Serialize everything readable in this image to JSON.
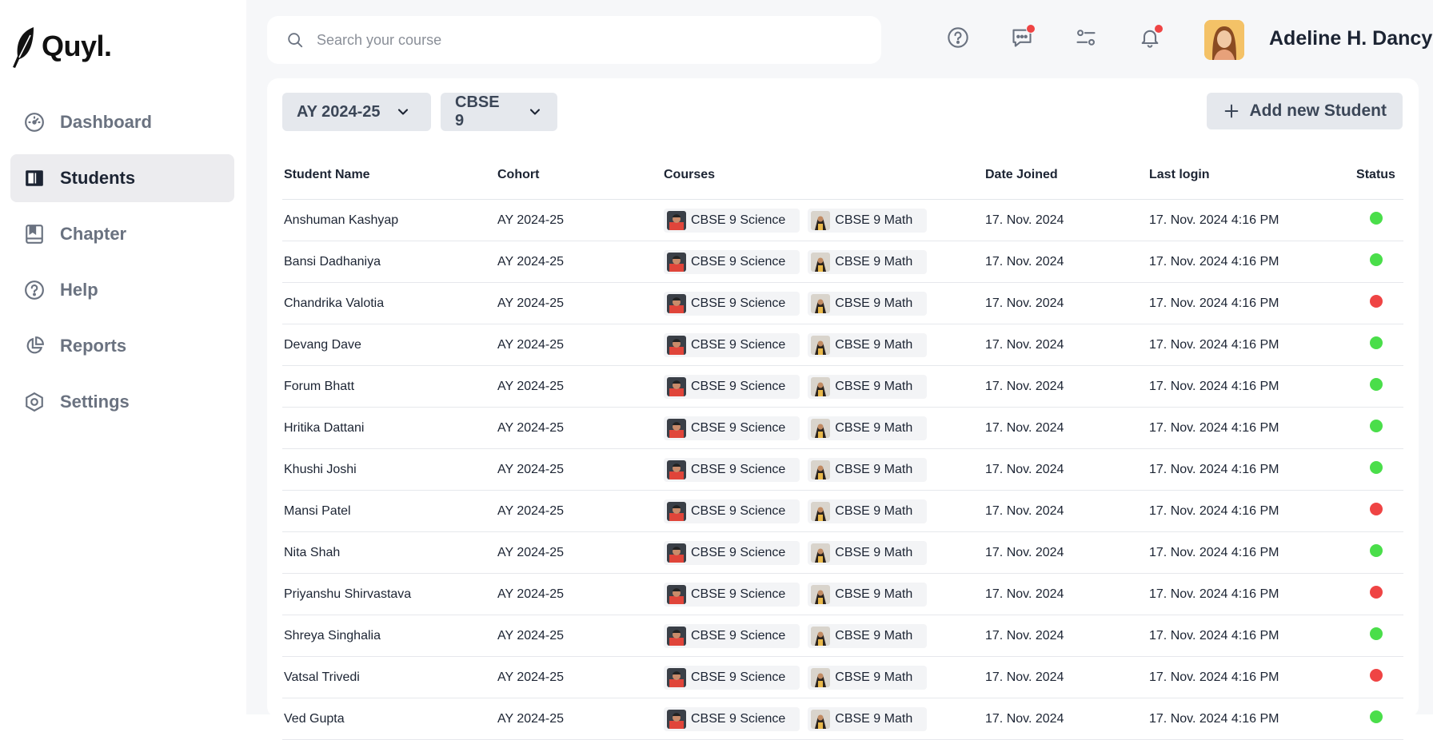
{
  "app": {
    "name": "Quyl."
  },
  "sidebar": {
    "items": [
      {
        "label": "Dashboard",
        "icon": "dashboard-gauge-icon",
        "active": false
      },
      {
        "label": "Students",
        "icon": "book-open-icon",
        "active": true
      },
      {
        "label": "Chapter",
        "icon": "bookmark-book-icon",
        "active": false
      },
      {
        "label": "Help",
        "icon": "help-circle-icon",
        "active": false
      },
      {
        "label": "Reports",
        "icon": "pie-chart-icon",
        "active": false
      },
      {
        "label": "Settings",
        "icon": "settings-hexagon-icon",
        "active": false
      }
    ]
  },
  "header": {
    "search_placeholder": "Search your course",
    "user_name": "Adeline H. Dancy"
  },
  "filters": {
    "year": "AY 2024-25",
    "class": "CBSE 9",
    "add_button": "Add new Student"
  },
  "table": {
    "columns": [
      "Student Name",
      "Cohort",
      "Courses",
      "Date Joined",
      "Last login",
      "Status"
    ],
    "rows": [
      {
        "name": "Anshuman Kashyap",
        "cohort": "AY 2024-25",
        "course1": "CBSE 9 Science",
        "course2": "CBSE 9 Math",
        "joined": "17. Nov. 2024",
        "last_login": "17. Nov. 2024 4:16 PM",
        "status": "active"
      },
      {
        "name": "Bansi Dadhaniya",
        "cohort": "AY 2024-25",
        "course1": "CBSE 9 Science",
        "course2": "CBSE 9 Math",
        "joined": "17. Nov. 2024",
        "last_login": "17. Nov. 2024 4:16 PM",
        "status": "active"
      },
      {
        "name": "Chandrika Valotia",
        "cohort": "AY 2024-25",
        "course1": "CBSE 9 Science",
        "course2": "CBSE 9 Math",
        "joined": "17. Nov. 2024",
        "last_login": "17. Nov. 2024 4:16 PM",
        "status": "inactive"
      },
      {
        "name": "Devang Dave",
        "cohort": "AY 2024-25",
        "course1": "CBSE 9 Science",
        "course2": "CBSE 9 Math",
        "joined": "17. Nov. 2024",
        "last_login": "17. Nov. 2024 4:16 PM",
        "status": "active"
      },
      {
        "name": "Forum Bhatt",
        "cohort": "AY 2024-25",
        "course1": "CBSE 9 Science",
        "course2": "CBSE 9 Math",
        "joined": "17. Nov. 2024",
        "last_login": "17. Nov. 2024 4:16 PM",
        "status": "active"
      },
      {
        "name": "Hritika Dattani",
        "cohort": "AY 2024-25",
        "course1": "CBSE 9 Science",
        "course2": "CBSE 9 Math",
        "joined": "17. Nov. 2024",
        "last_login": "17. Nov. 2024 4:16 PM",
        "status": "active"
      },
      {
        "name": "Khushi Joshi",
        "cohort": "AY 2024-25",
        "course1": "CBSE 9 Science",
        "course2": "CBSE 9 Math",
        "joined": "17. Nov. 2024",
        "last_login": "17. Nov. 2024 4:16 PM",
        "status": "active"
      },
      {
        "name": "Mansi Patel",
        "cohort": "AY 2024-25",
        "course1": "CBSE 9 Science",
        "course2": "CBSE 9 Math",
        "joined": "17. Nov. 2024",
        "last_login": "17. Nov. 2024 4:16 PM",
        "status": "inactive"
      },
      {
        "name": "Nita Shah",
        "cohort": "AY 2024-25",
        "course1": "CBSE 9 Science",
        "course2": "CBSE 9 Math",
        "joined": "17. Nov. 2024",
        "last_login": "17. Nov. 2024 4:16 PM",
        "status": "active"
      },
      {
        "name": "Priyanshu Shirvastava",
        "cohort": "AY 2024-25",
        "course1": "CBSE 9 Science",
        "course2": "CBSE 9 Math",
        "joined": "17. Nov. 2024",
        "last_login": "17. Nov. 2024 4:16 PM",
        "status": "inactive"
      },
      {
        "name": "Shreya Singhalia",
        "cohort": "AY 2024-25",
        "course1": "CBSE 9 Science",
        "course2": "CBSE 9 Math",
        "joined": "17. Nov. 2024",
        "last_login": "17. Nov. 2024 4:16 PM",
        "status": "active"
      },
      {
        "name": "Vatsal Trivedi",
        "cohort": "AY 2024-25",
        "course1": "CBSE 9 Science",
        "course2": "CBSE 9 Math",
        "joined": "17. Nov. 2024",
        "last_login": "17. Nov. 2024 4:16 PM",
        "status": "inactive"
      },
      {
        "name": "Ved Gupta",
        "cohort": "AY 2024-25",
        "course1": "CBSE 9 Science",
        "course2": "CBSE 9 Math",
        "joined": "17. Nov. 2024",
        "last_login": "17. Nov. 2024 4:16 PM",
        "status": "active"
      }
    ]
  },
  "colors": {
    "status_active": "#4ade4a",
    "status_inactive": "#ef4444",
    "notification_dot": "#ef4444"
  }
}
